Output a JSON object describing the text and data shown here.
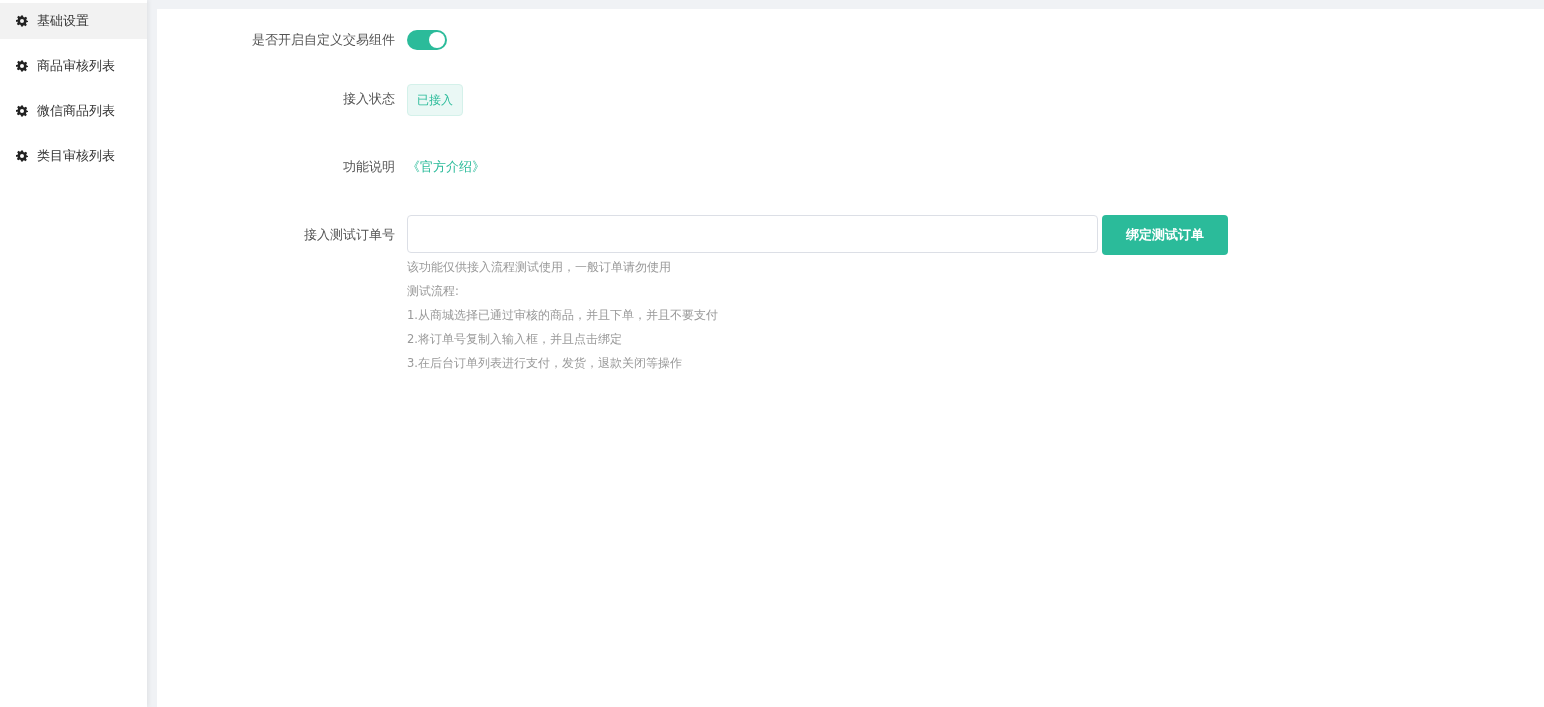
{
  "sidebar": {
    "items": [
      {
        "label": "基础设置",
        "selected": true
      },
      {
        "label": "商品审核列表",
        "selected": false
      },
      {
        "label": "微信商品列表",
        "selected": false
      },
      {
        "label": "类目审核列表",
        "selected": false
      }
    ]
  },
  "form": {
    "rows": [
      {
        "kind": "switch",
        "label": "是否开启自定义交易组件",
        "on": true
      },
      {
        "kind": "tag",
        "label": "接入状态",
        "value": "已接入"
      },
      {
        "kind": "link",
        "label": "功能说明",
        "value": "《官方介绍》"
      },
      {
        "kind": "input",
        "label": "接入测试订单号",
        "placeholder": "",
        "button": "绑定测试订单",
        "help": [
          "该功能仅供接入流程测试使用，一般订单请勿使用",
          "测试流程:",
          "1.从商城选择已通过审核的商品，并且下单，并且不要支付",
          "2.将订单号复制入输入框，并且点击绑定",
          "3.在后台订单列表进行支付，发货，退款关闭等操作"
        ]
      }
    ]
  }
}
